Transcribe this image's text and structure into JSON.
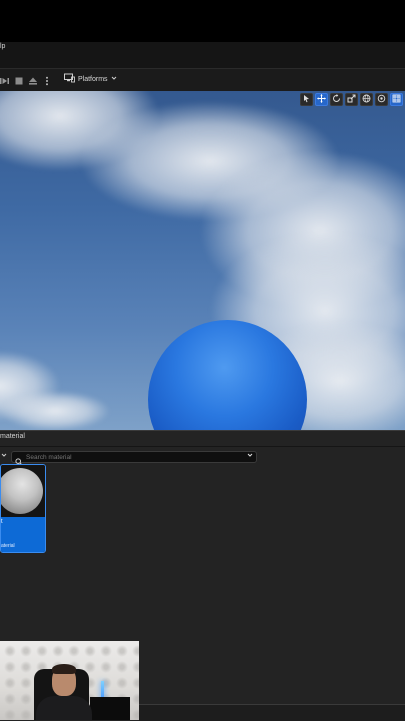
{
  "menubar": {
    "help_label": "lp"
  },
  "toolbar": {
    "platforms_label": "Platforms",
    "icons": [
      "skip-frame-icon",
      "stop-icon",
      "eject-icon",
      "more-options-icon",
      "platforms-icon"
    ]
  },
  "viewport": {
    "toolbar_icons": [
      "select-icon",
      "translate-icon",
      "rotate-icon",
      "scale-icon",
      "world-icon",
      "surface-snap-icon",
      "grid-snap-icon"
    ],
    "colors": {
      "sky_top": "#34598f",
      "sphere": "#2a78e0"
    }
  },
  "content_browser": {
    "tab_label": "material",
    "search": {
      "placeholder": "Search material",
      "value": ""
    },
    "asset": {
      "name": "t",
      "type": "aterial",
      "highlight_color": "#0d6ad6"
    }
  },
  "accent_color": "#2767c9"
}
